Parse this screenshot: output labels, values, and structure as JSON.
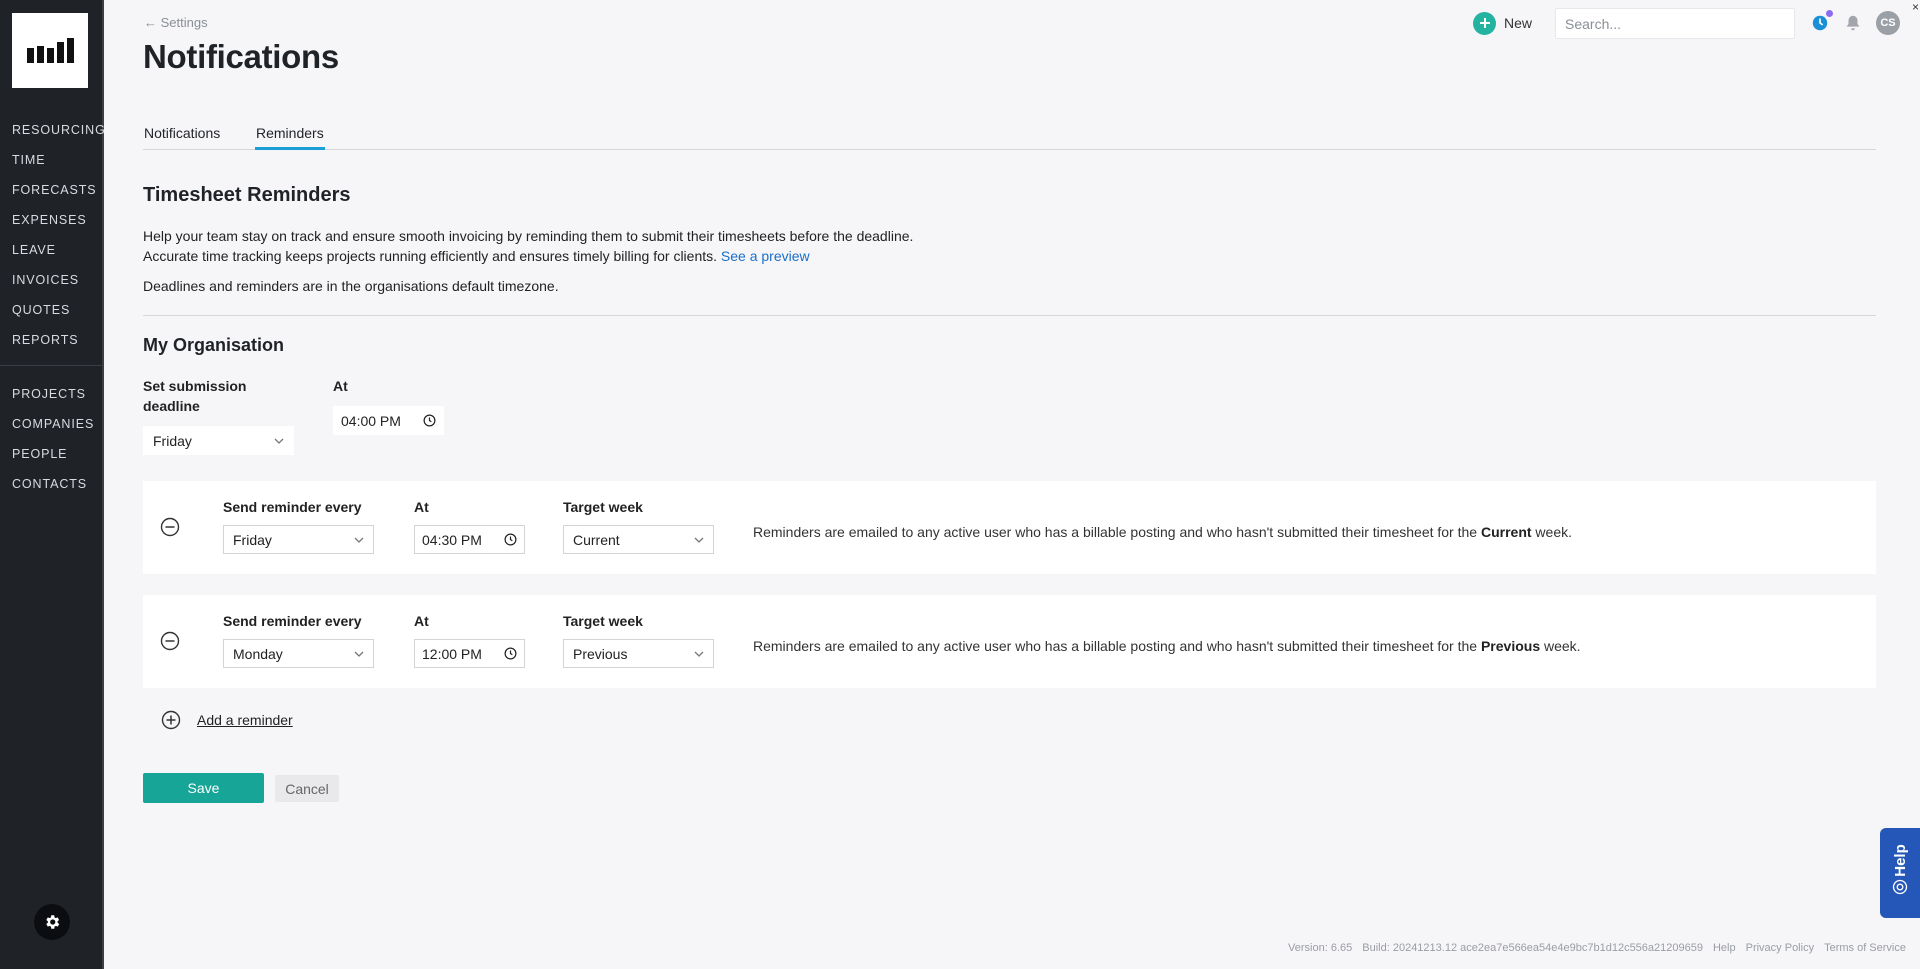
{
  "sidebar": {
    "logo_icon": "bar-chart-logo",
    "group1": [
      "RESOURCING",
      "TIME",
      "FORECASTS",
      "EXPENSES",
      "LEAVE",
      "INVOICES",
      "QUOTES",
      "REPORTS"
    ],
    "group2": [
      "PROJECTS",
      "COMPANIES",
      "PEOPLE",
      "CONTACTS"
    ],
    "settings_icon": "gear-icon"
  },
  "header": {
    "back_label": "← Settings",
    "title": "Notifications",
    "new_label": "New",
    "search_placeholder": "Search...",
    "avatar_initials": "CS",
    "corner_mark": "×"
  },
  "tabs": [
    {
      "label": "Notifications",
      "active": false
    },
    {
      "label": "Reminders",
      "active": true
    }
  ],
  "timesheet": {
    "title": "Timesheet Reminders",
    "desc1": "Help your team stay on track and ensure smooth invoicing by reminding them to submit their timesheets before the deadline.",
    "desc2_prefix": "Accurate time tracking keeps projects running efficiently and ensures timely billing for clients.",
    "preview_link": "See a preview",
    "desc3": "Deadlines and reminders are in the organisations default timezone."
  },
  "organisation": {
    "title": "My Organisation",
    "deadline_label_1": "Set submission",
    "deadline_label_2": "deadline",
    "deadline_value": "Friday",
    "at_label": "At",
    "deadline_time": "04:00 PM"
  },
  "reminders": [
    {
      "every_label": "Send reminder every",
      "day": "Friday",
      "at_label": "At",
      "time": "04:30 PM",
      "target_label": "Target week",
      "target": "Current",
      "text_prefix": "Reminders are emailed to any active user who has a billable posting and who hasn't submitted their timesheet for the",
      "text_week": "Current",
      "text_suffix": "week."
    },
    {
      "every_label": "Send reminder every",
      "day": "Monday",
      "at_label": "At",
      "time": "12:00 PM",
      "target_label": "Target week",
      "target": "Previous",
      "text_prefix": "Reminders are emailed to any active user who has a billable posting and who hasn't submitted their timesheet for the",
      "text_week": "Previous",
      "text_suffix": "week."
    }
  ],
  "actions": {
    "add_reminder": "Add a reminder",
    "save": "Save",
    "cancel": "Cancel"
  },
  "help_label": "Help",
  "footer": {
    "version": "Version: 6.65",
    "build": "Build: 20241213.12 ace2ea7e566ea54e4e9bc7b1d12c556a21209659",
    "help": "Help",
    "privacy": "Privacy Policy",
    "terms": "Terms of Service"
  },
  "colors": {
    "accent_teal": "#17a597",
    "tab_underline": "#1a9fd6",
    "link_blue": "#1a6fc9",
    "sidebar_bg": "#1f2328",
    "help_blue": "#2557b8"
  }
}
